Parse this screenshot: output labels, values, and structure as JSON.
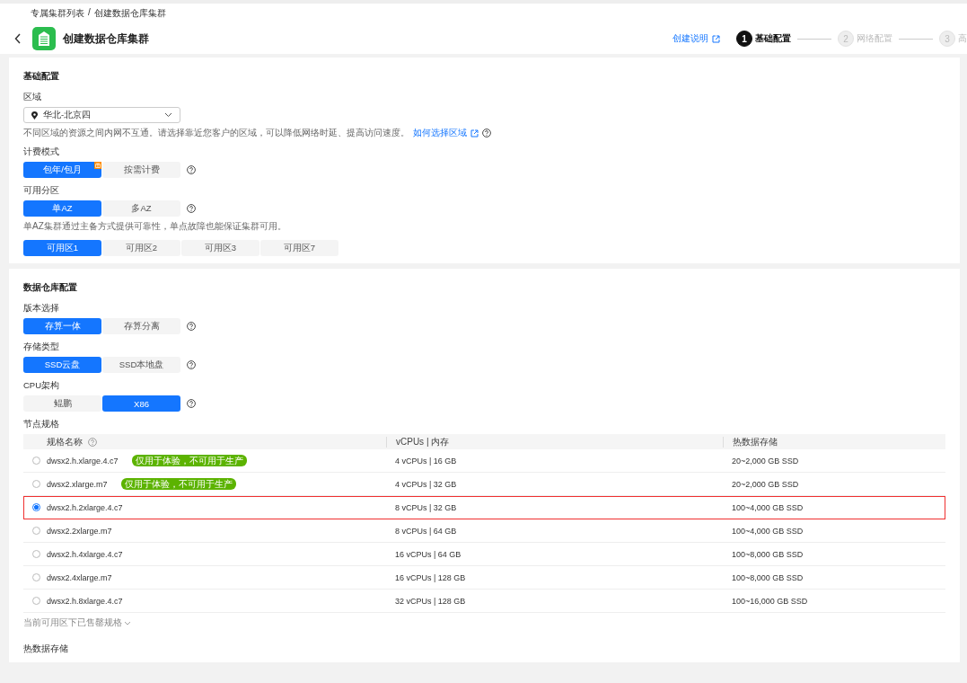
{
  "breadcrumb": {
    "items": [
      "专属集群列表",
      "创建数据仓库集群"
    ],
    "separator": "/"
  },
  "header": {
    "title": "创建数据仓库集群",
    "help_link": "创建说明",
    "steps": [
      {
        "number": "1",
        "label": "基础配置",
        "selected": true
      },
      {
        "number": "2",
        "label": "网络配置",
        "selected": false
      },
      {
        "number": "3",
        "label": "高",
        "selected": false
      }
    ]
  },
  "sections": [
    {
      "title": "基础配置",
      "fields": [
        {
          "kind": "select",
          "label": "区域",
          "value": "华北-北京四",
          "hint": "不同区域的资源之间内网不互通。请选择靠近您客户的区域，可以降低网络时延、提高访问速度。",
          "hint_link": "如何选择区域"
        },
        {
          "kind": "segmented",
          "label": "计费模式",
          "help": true,
          "options": [
            {
              "label": "包年/包月",
              "selected": true,
              "promo": true
            },
            {
              "label": "按需计费",
              "selected": false,
              "promo": false
            }
          ]
        },
        {
          "kind": "segmented",
          "label": "可用分区",
          "help": true,
          "options": [
            {
              "label": "单AZ",
              "selected": true,
              "promo": false
            },
            {
              "label": "多AZ",
              "selected": false,
              "promo": false
            }
          ],
          "hint": "单AZ集群通过主备方式提供可靠性，单点故障也能保证集群可用。"
        },
        {
          "kind": "segmented",
          "help": false,
          "options": [
            {
              "label": "可用区1",
              "selected": true,
              "promo": false
            },
            {
              "label": "可用区2",
              "selected": false,
              "promo": false
            },
            {
              "label": "可用区3",
              "selected": false,
              "promo": false
            },
            {
              "label": "可用区7",
              "selected": false,
              "promo": false
            }
          ]
        }
      ]
    },
    {
      "title": "数据仓库配置",
      "fields": [
        {
          "kind": "segmented",
          "label": "版本选择",
          "help": true,
          "options": [
            {
              "label": "存算一体",
              "selected": true,
              "promo": false
            },
            {
              "label": "存算分离",
              "selected": false,
              "promo": false
            }
          ]
        },
        {
          "kind": "segmented",
          "label": "存储类型",
          "help": true,
          "options": [
            {
              "label": "SSD云盘",
              "selected": true,
              "promo": false
            },
            {
              "label": "SSD本地盘",
              "selected": false,
              "promo": false
            }
          ]
        },
        {
          "kind": "segmented",
          "label": "CPU架构",
          "help": true,
          "options": [
            {
              "label": "鲲鹏",
              "selected": false,
              "promo": false
            },
            {
              "label": "X86",
              "selected": true,
              "promo": false
            }
          ]
        },
        {
          "kind": "table",
          "label": "节点规格",
          "columns": [
            {
              "label": "规格名称",
              "help": true
            },
            {
              "label": "vCPUs | 内存",
              "help": false
            },
            {
              "label": "热数据存储",
              "help": false
            }
          ],
          "rows": [
            {
              "name": "dwsx2.h.xlarge.4.c7",
              "tag": "仅用于体验，不可用于生产",
              "cpu_memory": "4 vCPUs | 16 GB",
              "storage": "20~2,000 GB SSD",
              "selected": false
            },
            {
              "name": "dwsx2.xlarge.m7",
              "tag": "仅用于体验，不可用于生产",
              "cpu_memory": "4 vCPUs | 32 GB",
              "storage": "20~2,000 GB SSD",
              "selected": false
            },
            {
              "name": "dwsx2.h.2xlarge.4.c7",
              "cpu_memory": "8 vCPUs | 32 GB",
              "storage": "100~4,000 GB SSD",
              "selected": true
            },
            {
              "name": "dwsx2.2xlarge.m7",
              "cpu_memory": "8 vCPUs | 64 GB",
              "storage": "100~4,000 GB SSD",
              "selected": false
            },
            {
              "name": "dwsx2.h.4xlarge.4.c7",
              "cpu_memory": "16 vCPUs | 64 GB",
              "storage": "100~8,000 GB SSD",
              "selected": false
            },
            {
              "name": "dwsx2.4xlarge.m7",
              "cpu_memory": "16 vCPUs | 128 GB",
              "storage": "100~8,000 GB SSD",
              "selected": false
            },
            {
              "name": "dwsx2.h.8xlarge.4.c7",
              "cpu_memory": "32 vCPUs | 128 GB",
              "storage": "100~16,000 GB SSD",
              "selected": false
            }
          ],
          "footer": "当前可用区下已售罄规格"
        },
        {
          "kind": "label",
          "label": "热数据存储"
        }
      ]
    }
  ]
}
